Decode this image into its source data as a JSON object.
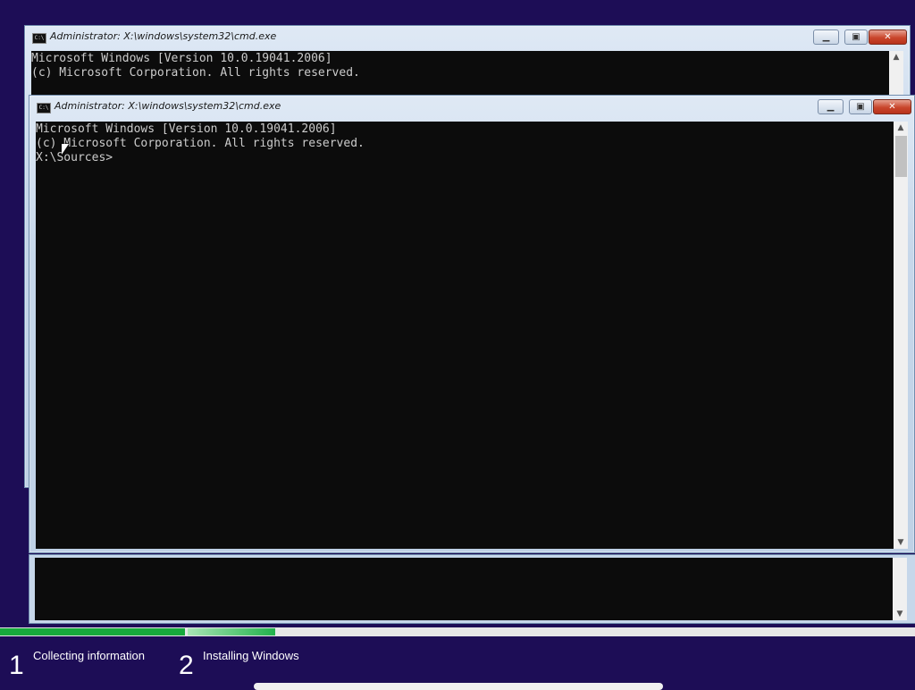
{
  "back_window": {
    "icon": "cmd-icon",
    "icon_text": "C:\\",
    "title": "Administrator: X:\\windows\\system32\\cmd.exe",
    "lines": [
      "Microsoft Windows [Version 10.0.19041.2006]",
      "(c) Microsoft Corporation. All rights reserved."
    ]
  },
  "front_window": {
    "icon": "cmd-icon",
    "icon_text": "C:\\",
    "title": "Administrator: X:\\windows\\system32\\cmd.exe",
    "lines": [
      "Microsoft Windows [Version 10.0.19041.2006]",
      "(c) Microsoft Corporation. All rights reserved.",
      "",
      "X:\\Sources>"
    ]
  },
  "window_controls": {
    "minimize_glyph": "▁",
    "maximize_glyph": "▣",
    "close_glyph": "✕"
  },
  "scroll_arrows": {
    "up": "▲",
    "down": "▼"
  },
  "setup_progress": {
    "steps": [
      {
        "number": "1",
        "label": "Collecting information",
        "progress": 1.0
      },
      {
        "number": "2",
        "label": "Installing Windows",
        "progress": 0.2
      }
    ],
    "colors": {
      "complete": "#17a93c",
      "background": "#1d0d56"
    }
  }
}
